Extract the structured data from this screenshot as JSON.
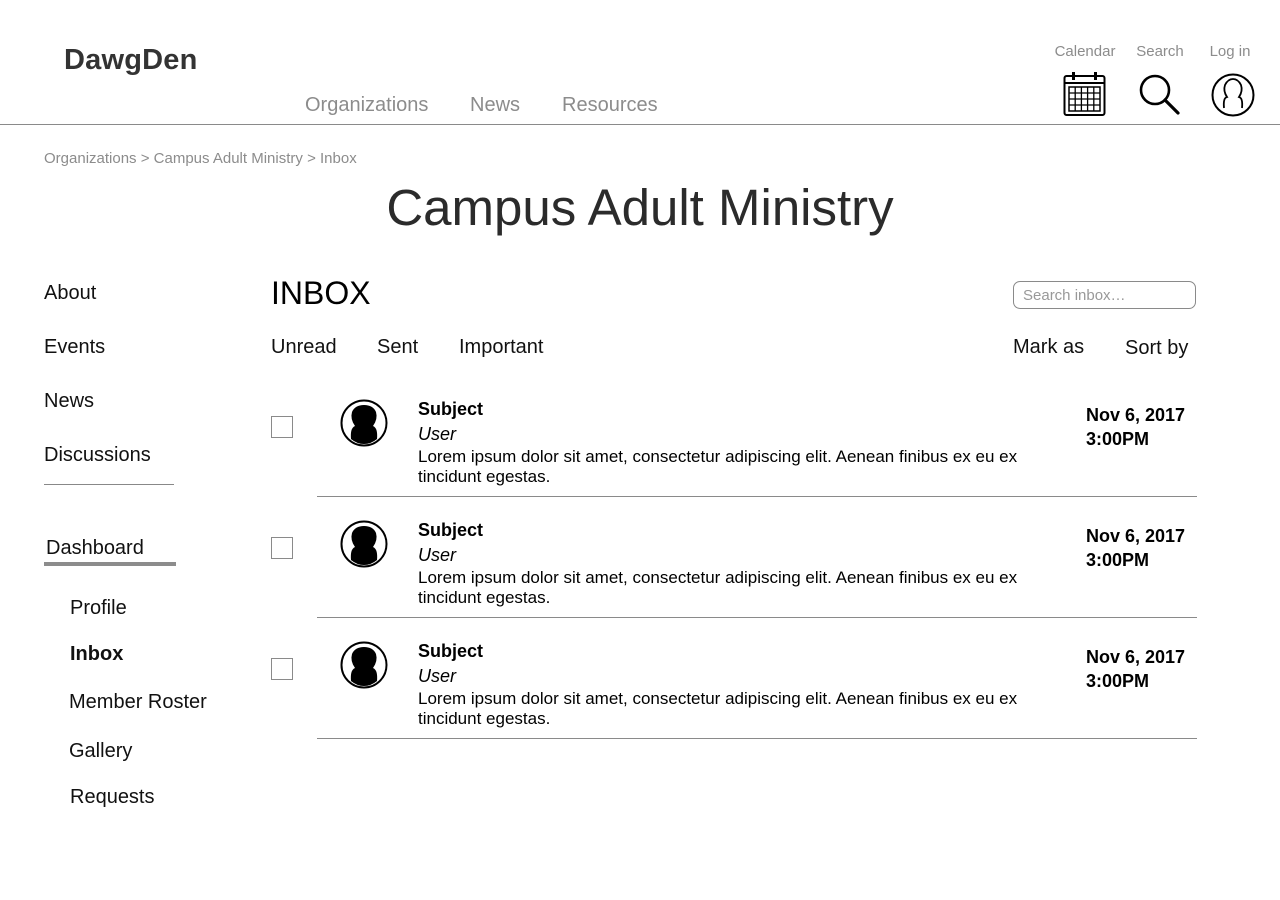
{
  "header": {
    "logo": "DawgDen",
    "nav": [
      "Organizations",
      "News",
      "Resources"
    ],
    "utility": [
      {
        "label": "Calendar",
        "icon": "calendar-icon"
      },
      {
        "label": "Search",
        "icon": "search-icon"
      },
      {
        "label": "Log in",
        "icon": "user-icon"
      }
    ]
  },
  "breadcrumb": [
    "Organizations",
    "Campus Adult Ministry",
    "Inbox"
  ],
  "breadcrumb_separator": ">",
  "page_title": "Campus Adult Ministry",
  "sidebar": {
    "items": [
      "About",
      "Events",
      "News",
      "Discussions"
    ],
    "dashboard_label": "Dashboard",
    "dashboard_items": [
      "Profile",
      "Inbox",
      "Member Roster",
      "Gallery",
      "Requests"
    ],
    "active_item": "Inbox"
  },
  "inbox": {
    "title": "INBOX",
    "search_placeholder": "Search inbox…",
    "filters": [
      "Unread",
      "Sent",
      "Important"
    ],
    "actions": [
      "Mark as",
      "Sort by"
    ],
    "messages": [
      {
        "subject": "Subject",
        "user": "User",
        "preview": "Lorem ipsum dolor sit amet, consectetur adipiscing elit. Aenean finibus ex eu ex tincidunt egestas.",
        "date": "Nov 6, 2017",
        "time": "3:00PM"
      },
      {
        "subject": "Subject",
        "user": "User",
        "preview": "Lorem ipsum dolor sit amet, consectetur adipiscing elit. Aenean finibus ex eu ex tincidunt egestas.",
        "date": "Nov 6, 2017",
        "time": "3:00PM"
      },
      {
        "subject": "Subject",
        "user": "User",
        "preview": "Lorem ipsum dolor sit amet, consectetur adipiscing elit. Aenean finibus ex eu ex tincidunt egestas.",
        "date": "Nov 6, 2017",
        "time": "3:00PM"
      }
    ]
  }
}
